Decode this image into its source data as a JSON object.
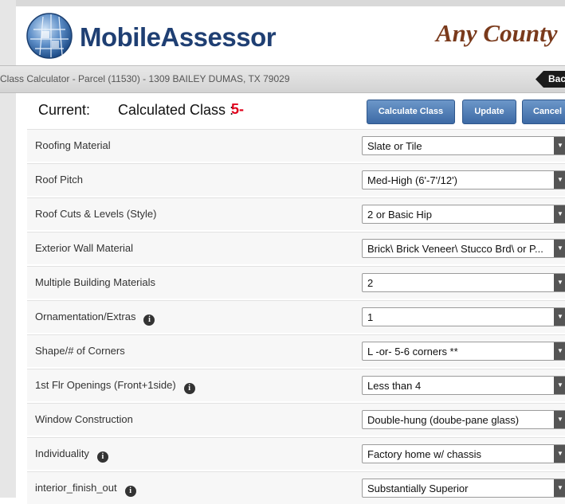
{
  "header": {
    "app_name": "MobileAssessor",
    "county_name": "Any County"
  },
  "breadcrumb": {
    "text": "Class Calculator - Parcel (11530) - 1309 BAILEY DUMAS, TX 79029",
    "back_label": "Back"
  },
  "status": {
    "current_label": "Current:",
    "calculated_class_label": "Calculated Class :",
    "calculated_class_value": "5-"
  },
  "actions": {
    "calculate_label": "Calculate Class",
    "update_label": "Update",
    "cancel_label": "Cancel"
  },
  "fields": [
    {
      "label": "Roofing Material",
      "value": "Slate or Tile",
      "info": false
    },
    {
      "label": "Roof Pitch",
      "value": "Med-High (6'-7'/12')",
      "info": false
    },
    {
      "label": "Roof Cuts & Levels (Style)",
      "value": "2 or Basic Hip",
      "info": false
    },
    {
      "label": "Exterior Wall Material",
      "value": "Brick\\ Brick Veneer\\ Stucco Brd\\ or P...",
      "info": false
    },
    {
      "label": "Multiple Building Materials",
      "value": "2",
      "info": false
    },
    {
      "label": "Ornamentation/Extras",
      "value": "1",
      "info": true
    },
    {
      "label": "Shape/# of Corners",
      "value": "L -or- 5-6 corners **",
      "info": false
    },
    {
      "label": "1st Flr Openings (Front+1side)",
      "value": "Less than 4",
      "info": true
    },
    {
      "label": "Window Construction",
      "value": "Double-hung (doube-pane glass)",
      "info": false
    },
    {
      "label": "Individuality",
      "value": "Factory home w/ chassis",
      "info": true
    },
    {
      "label": "interior_finish_out",
      "value": "Substantially Superior",
      "info": true
    }
  ],
  "icons": {
    "info": "info-icon",
    "dropdown": "chevron-down-icon",
    "logo": "globe-logo-icon"
  },
  "colors": {
    "brand_text": "#1f3f73",
    "county_text": "#7a3a1c",
    "class_value": "#e0001b",
    "button": "#4a76b0"
  }
}
